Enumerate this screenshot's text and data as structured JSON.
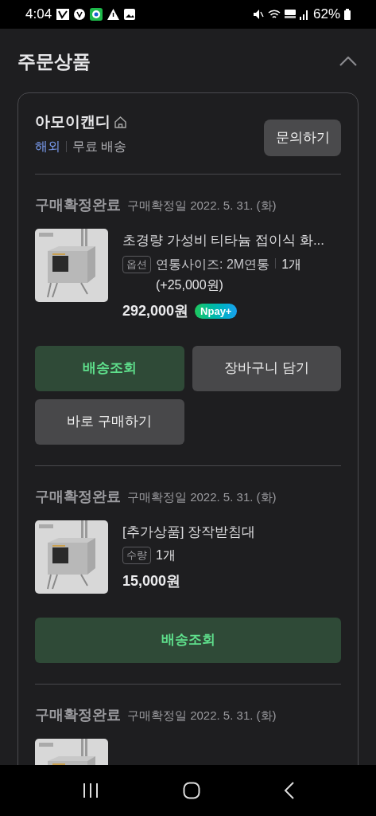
{
  "status_bar": {
    "time": "4:04",
    "battery": "62%"
  },
  "section": {
    "title": "주문상품",
    "expanded": true
  },
  "store": {
    "name": "아모이캔디",
    "origin": "해외",
    "shipping": "무료 배송",
    "inquiry_button": "문의하기"
  },
  "items": [
    {
      "status": "구매확정완료",
      "date": "구매확정일 2022. 5. 31. (화)",
      "title": "초경량 가성비 티타늄 접이식 화...",
      "option": {
        "label": "옵션",
        "text": "연통사이즈: 2M연통",
        "quantity": "1개 (+25,000원)"
      },
      "price": "292,000원",
      "badge": "Npay+",
      "buttons": [
        {
          "label": "배송조회",
          "kind": "track"
        },
        {
          "label": "장바구니 담기",
          "kind": "plain"
        },
        {
          "label": "바로 구매하기",
          "kind": "plain"
        }
      ]
    },
    {
      "status": "구매확정완료",
      "date": "구매확정일 2022. 5. 31. (화)",
      "title": "[추가상품] 장작받침대",
      "option": {
        "label": "수량",
        "quantity": "1개"
      },
      "price": "15,000원",
      "buttons": [
        {
          "label": "배송조회",
          "kind": "track",
          "wide": true
        }
      ]
    },
    {
      "status": "구매확정완료",
      "date": "구매확정일 2022. 5. 31. (화)"
    }
  ]
}
